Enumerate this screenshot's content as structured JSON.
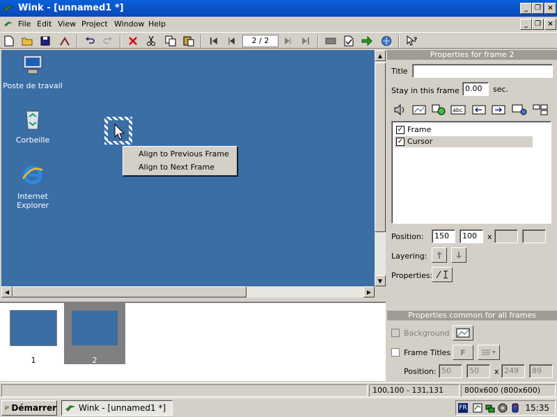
{
  "window": {
    "title": "Wink - [unnamed1 *]",
    "min_glyph": "_",
    "restore_glyph": "❐",
    "close_glyph": "×"
  },
  "menu": {
    "items": [
      "File",
      "Edit",
      "View",
      "Project",
      "Window",
      "Help"
    ]
  },
  "toolbar": {
    "frame_counter": "2 / 2"
  },
  "desktop": {
    "icons": [
      {
        "label": "Poste de travail",
        "icon": "computer-icon"
      },
      {
        "label": "Corbeille",
        "icon": "recycle-bin-icon"
      },
      {
        "label": "Internet Explorer",
        "icon": "internet-explorer-icon"
      }
    ]
  },
  "context_menu": {
    "items": [
      "Align to Previous Frame",
      "Align to Next Frame"
    ]
  },
  "thumbnails": [
    {
      "number": "1",
      "selected": false
    },
    {
      "number": "2",
      "selected": true
    }
  ],
  "frame_properties": {
    "header": "Properties for frame 2",
    "title_label": "Title",
    "title_value": "",
    "stay_label": "Stay in this frame for",
    "stay_value": "0.00",
    "stay_unit": "sec.",
    "items": [
      {
        "label": "Frame",
        "checked": true
      },
      {
        "label": "Cursor",
        "checked": true
      }
    ],
    "position_label": "Position:",
    "position_x": "150",
    "position_y": "100",
    "size_separator": "x",
    "size_w": "",
    "size_h": "",
    "layering_label": "Layering:",
    "properties_label": "Properties:"
  },
  "common_properties": {
    "header": "Properties common for all frames",
    "background_label": "Background",
    "frame_titles_label": "Frame Titles",
    "font_glyph": "F",
    "position_label": "Position:",
    "pos_x": "50",
    "pos_y": "50",
    "size_separator": "x",
    "size_w": "249",
    "size_h": "89"
  },
  "statusbar": {
    "coords": "100,100 - 131,131",
    "dimensions": "800x600 (800x600)"
  },
  "taskbar": {
    "start_label": "Démarrer",
    "task_label": "Wink - [unnamed1 *]",
    "language": "FR",
    "clock": "15:35"
  }
}
